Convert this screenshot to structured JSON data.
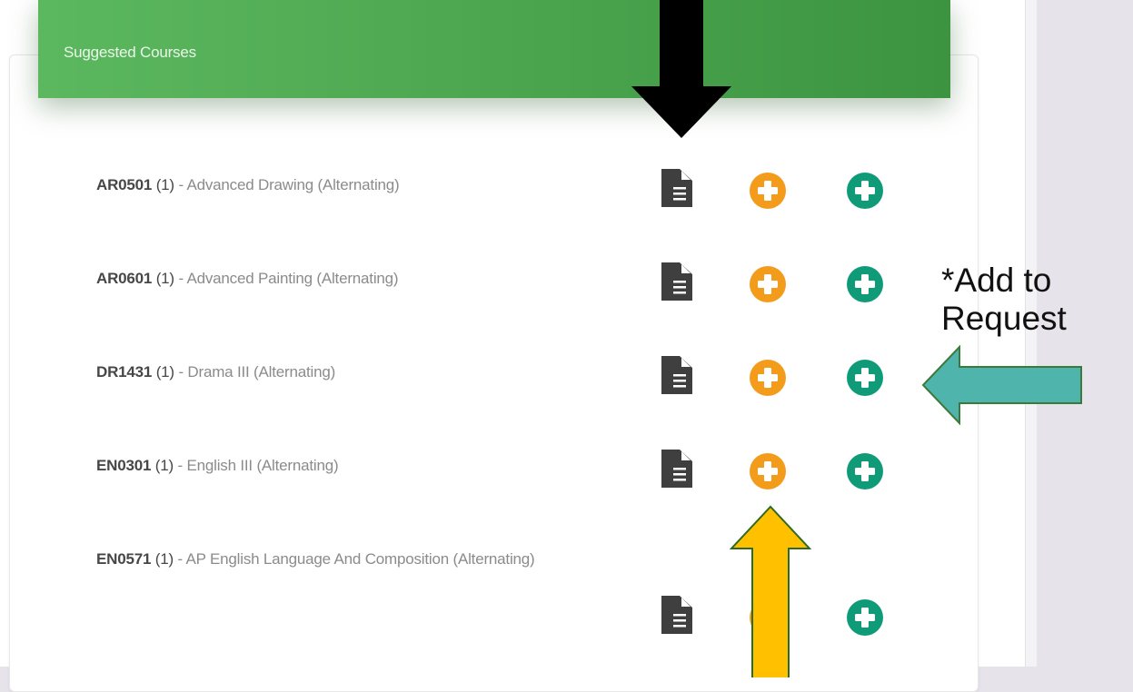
{
  "panel": {
    "title": "Suggested Courses"
  },
  "courses": [
    {
      "code": "AR0501",
      "credit": "(1)",
      "name": "- Advanced Drawing (Alternating)"
    },
    {
      "code": "AR0601",
      "credit": "(1)",
      "name": "- Advanced Painting (Alternating)"
    },
    {
      "code": "DR1431",
      "credit": "(1)",
      "name": "- Drama III (Alternating)"
    },
    {
      "code": "EN0301",
      "credit": "(1)",
      "name": "- English III (Alternating)"
    },
    {
      "code": "EN0571",
      "credit": "(1)",
      "name": "- AP English Language And Composition (Alternating)"
    }
  ],
  "icons": {
    "details": "document-icon",
    "orange_add": "plus-circle-icon",
    "green_add": "plus-circle-icon"
  },
  "annotation": {
    "line1": "*Add to",
    "line2": "Request"
  },
  "colors": {
    "header_green": "#4caf50",
    "orange": "#f39c1c",
    "teal": "#109b78",
    "doc_gray": "#3f3f3f",
    "arrow_black": "#000000",
    "arrow_teal": "#4fb5ac",
    "arrow_yellow": "#ffc000"
  }
}
